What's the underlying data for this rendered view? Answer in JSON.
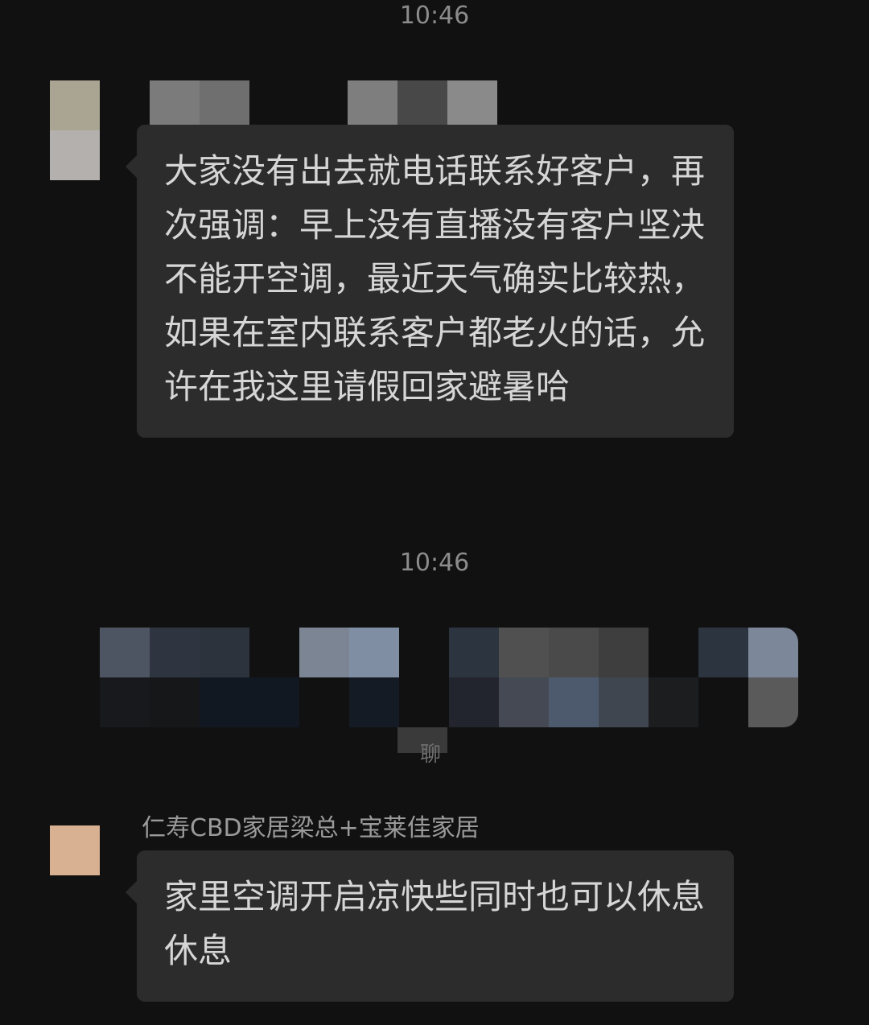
{
  "messages": [
    {
      "time": "10:46",
      "text": "大家没有出去就电话联系好客户，再次强调：早上没有直播没有客户坚决不能开空调，最近天气确实比较热，如果在室内联系客户都老火的话，允许在我这里请假回家避暑哈"
    },
    {
      "time": "10:46",
      "fragment": "聊"
    },
    {
      "sender": "仁寿CBD家居梁总+宝莱佳家居",
      "text": "家里空调开启凉快些同时也可以休息休息"
    }
  ]
}
